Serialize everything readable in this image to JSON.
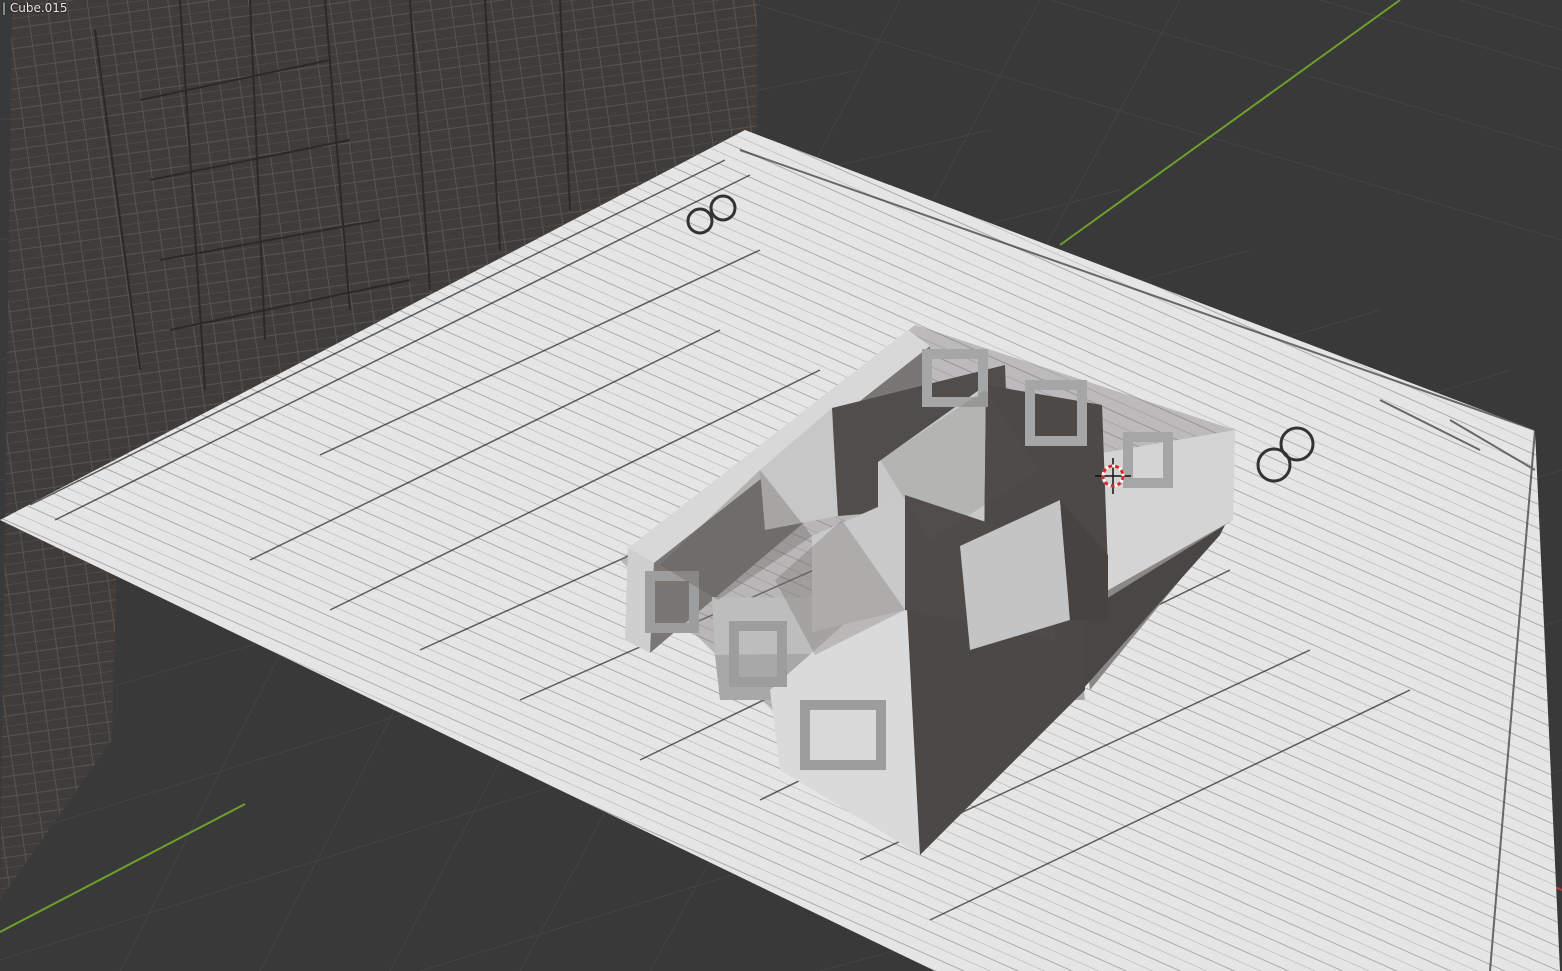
{
  "viewport": {
    "object_label": "| Cube.015"
  },
  "colors": {
    "background": "#393939",
    "grid_line": "#444444",
    "x_axis": "#c03a3a",
    "y_axis": "#6da12c",
    "paper": "#e6e6e6",
    "back_panel": "#3f3b39",
    "wall_light": "#c2c2c2",
    "wall_dark": "#484442"
  },
  "icons": {
    "cursor": "3d-cursor-icon"
  }
}
